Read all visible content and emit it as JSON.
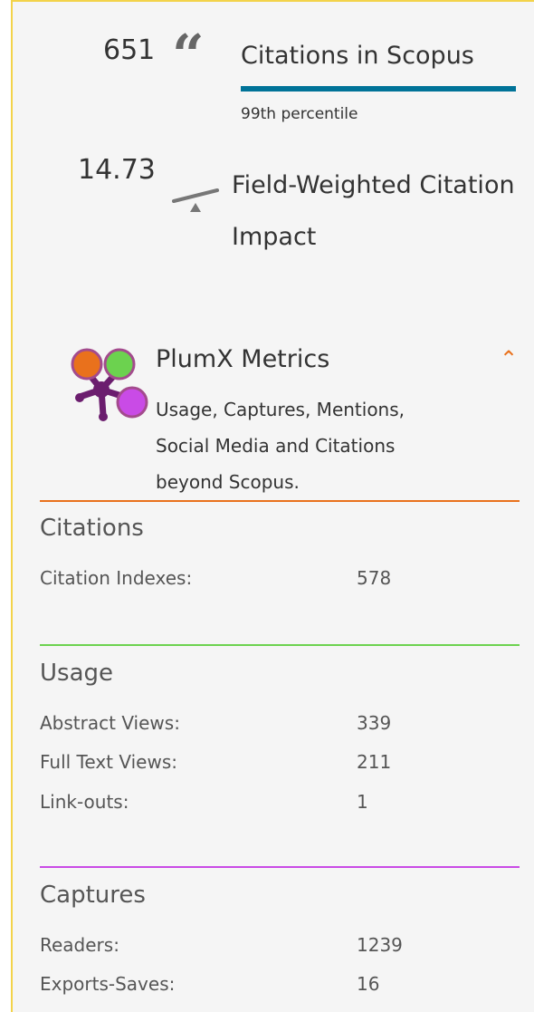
{
  "citations": {
    "count": "651",
    "label": "Citations in Scopus",
    "percentile": "99th percentile"
  },
  "fwci": {
    "value": "14.73",
    "label": "Field-Weighted Citation Impact"
  },
  "plumx": {
    "title": "PlumX Metrics",
    "description": "Usage, Captures, Mentions, Social Media and Citations beyond Scopus.",
    "colors": {
      "citations": "#e9711c",
      "usage": "#6cd24f",
      "captures": "#c94be6",
      "hub": "#6b1d6e"
    }
  },
  "sections": {
    "citations": {
      "title": "Citations",
      "rows": [
        {
          "label": "Citation Indexes:",
          "value": "578"
        }
      ]
    },
    "usage": {
      "title": "Usage",
      "rows": [
        {
          "label": "Abstract Views:",
          "value": "339"
        },
        {
          "label": "Full Text Views:",
          "value": "211"
        },
        {
          "label": "Link-outs:",
          "value": "1"
        }
      ]
    },
    "captures": {
      "title": "Captures",
      "rows": [
        {
          "label": "Readers:",
          "value": "1239"
        },
        {
          "label": "Exports-Saves:",
          "value": "16"
        }
      ]
    }
  }
}
